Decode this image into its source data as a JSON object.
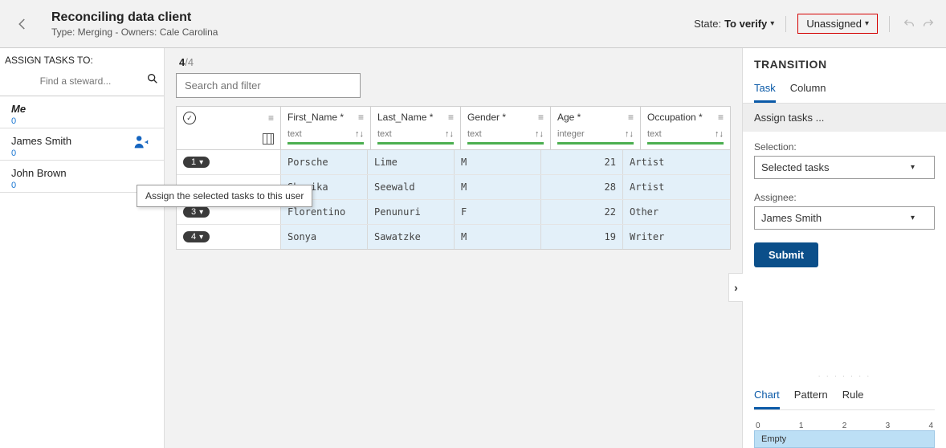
{
  "header": {
    "title": "Reconciling data client",
    "subtitle": "Type: Merging - Owners: Cale Carolina",
    "state_label": "State:",
    "state_value": "To verify",
    "unassigned": "Unassigned"
  },
  "left": {
    "assign_label": "ASSIGN TASKS TO:",
    "search_placeholder": "Find a steward...",
    "stewards": [
      {
        "name": "Me",
        "count": "0",
        "me": true
      },
      {
        "name": "James Smith",
        "count": "0",
        "me": false,
        "icon": true
      },
      {
        "name": "John Brown",
        "count": "0",
        "me": false
      }
    ],
    "tooltip": "Assign the selected tasks to this user"
  },
  "grid": {
    "count_bold": "4",
    "count_total": "/4",
    "search_placeholder": "Search and filter",
    "columns": [
      {
        "name": "First_Name *",
        "type": "text"
      },
      {
        "name": "Last_Name *",
        "type": "text"
      },
      {
        "name": "Gender *",
        "type": "text"
      },
      {
        "name": "Age *",
        "type": "integer"
      },
      {
        "name": "Occupation *",
        "type": "text"
      }
    ],
    "rows": [
      {
        "pill": "1",
        "first": "Porsche",
        "last": "Lime",
        "gender": "M",
        "age": "21",
        "occ": "Artist"
      },
      {
        "pill": "",
        "first": "Shenika",
        "last": "Seewald",
        "gender": "M",
        "age": "28",
        "occ": "Artist"
      },
      {
        "pill": "3",
        "first": "Florentino",
        "last": "Penunuri",
        "gender": "F",
        "age": "22",
        "occ": "Other"
      },
      {
        "pill": "4",
        "first": "Sonya",
        "last": "Sawatzke",
        "gender": "M",
        "age": "19",
        "occ": "Writer"
      }
    ]
  },
  "right": {
    "title": "TRANSITION",
    "tabs": [
      "Task",
      "Column"
    ],
    "section": "Assign tasks ...",
    "selection_label": "Selection:",
    "selection_value": "Selected tasks",
    "assignee_label": "Assignee:",
    "assignee_value": "James Smith",
    "submit": "Submit",
    "tabs2": [
      "Chart",
      "Pattern",
      "Rule"
    ],
    "scale": [
      "0",
      "1",
      "2",
      "3",
      "4"
    ],
    "empty": "Empty"
  }
}
